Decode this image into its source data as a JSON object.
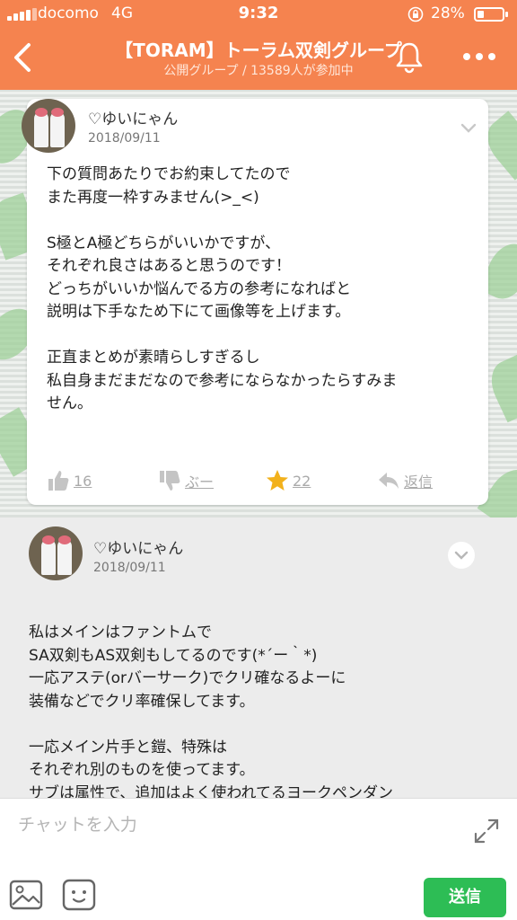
{
  "status_bar": {
    "carrier": "docomo",
    "network": "4G",
    "time": "9:32",
    "battery": "28%"
  },
  "header": {
    "title": "【TORAM】トーラム双剣グループ",
    "subtitle": "公開グループ / 13589人が参加中",
    "accent_color": "#f5834f"
  },
  "post1": {
    "author": "♡ゆいにゃん",
    "date": "2018/09/11",
    "text": "下の質問あたりでお約束してたので\nまた再度一枠すみません(>_<)\n\nS極とA極どちらがいいかですが、\nそれぞれ良さはあると思うのです！\nどっちがいいか悩んでる方の参考になればと\n説明は下手なため下にて画像等を上げます。\n\n正直まとめが素晴らしすぎるし\n私自身まだまだなので参考にならなかったらすみま\nせん。",
    "actions": {
      "like": "16",
      "boo": "ぶー",
      "star": "22",
      "reply": "返信"
    }
  },
  "post2": {
    "author": "♡ゆいにゃん",
    "date": "2018/09/11",
    "text": "私はメインはファントムで\nSA双剣もAS双剣もしてるのです(*´ー｀*)\n一応アステ(orバーサーク)でクリ確なるよーに\n装備などでクリ率確保してます。\n\n一応メイン片手と鎧、特殊は\nそれぞれ別のものを使ってます。\nサブは属性で、追加はよく使われてるヨークペンダン"
  },
  "input": {
    "placeholder": "チャットを入力",
    "send_label": "送信"
  },
  "icons": [
    "back-icon",
    "bell-icon",
    "more-icon",
    "chevron-down-icon",
    "thumbs-up-icon",
    "thumbs-down-icon",
    "star-icon",
    "reply-icon",
    "expand-icon",
    "image-icon",
    "emoji-icon",
    "lock-rotation-icon"
  ]
}
